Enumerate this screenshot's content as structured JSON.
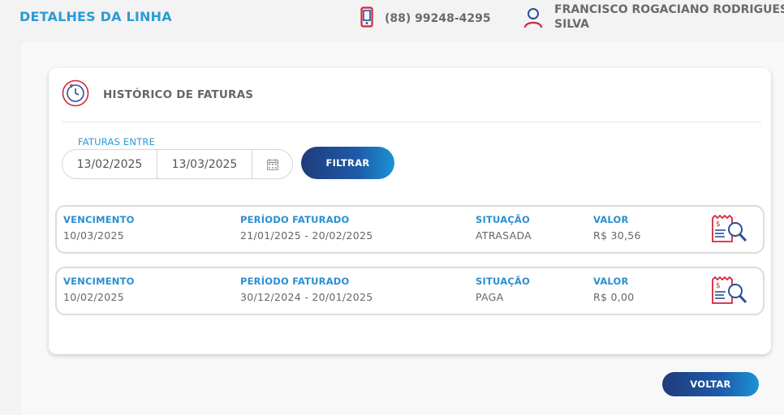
{
  "header": {
    "title": "DETALHES DA LINHA",
    "phone": "(88) 99248-4295",
    "user_name": "FRANCISCO ROGACIANO RODRIGUES SILVA"
  },
  "invoice_history": {
    "title": "HISTÓRICO DE FATURAS",
    "filter": {
      "label": "FATURAS ENTRE",
      "start_date": "13/02/2025",
      "end_date": "13/03/2025",
      "button_label": "FILTRAR"
    },
    "columns": {
      "due": "VENCIMENTO",
      "period": "PERÍODO FATURADO",
      "status": "SITUAÇÃO",
      "value": "VALOR"
    },
    "rows": [
      {
        "due": "10/03/2025",
        "period": "21/01/2025 - 20/02/2025",
        "status": "ATRASADA",
        "value": "R$ 30,56"
      },
      {
        "due": "10/02/2025",
        "period": "30/12/2024 - 20/01/2025",
        "status": "PAGA",
        "value": "R$ 0,00"
      }
    ]
  },
  "footer": {
    "back_label": "VOLTAR"
  },
  "colors": {
    "accent": "#2a9bd6",
    "icon_red": "#d5263b",
    "button_dark": "#1f3c7a",
    "button_light": "#1a93d6"
  }
}
